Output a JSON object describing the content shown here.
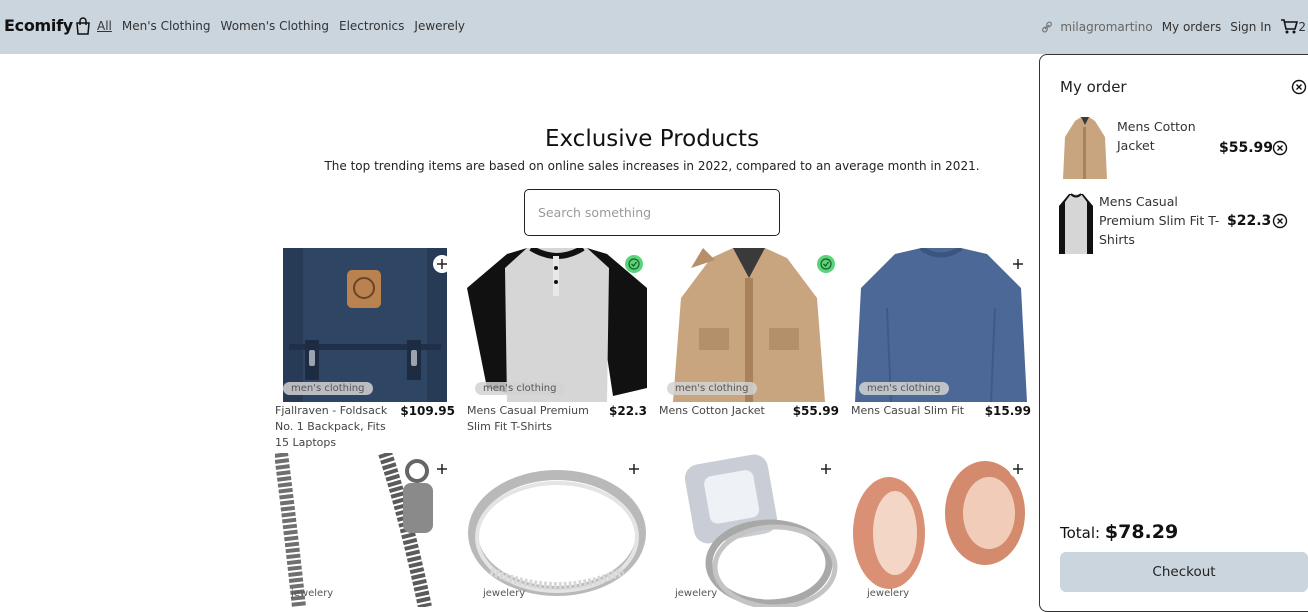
{
  "brand": {
    "name": "Ecomify"
  },
  "nav": {
    "links": [
      {
        "label": "All"
      },
      {
        "label": "Men's Clothing"
      },
      {
        "label": "Women's Clothing"
      },
      {
        "label": "Electronics"
      },
      {
        "label": "Jewerely"
      }
    ],
    "username": "milagromartino",
    "my_orders": "My orders",
    "sign_in": "Sign In",
    "cart_count": "2"
  },
  "hero": {
    "title": "Exclusive Products",
    "subtitle": "The top trending items are based on online sales increases in 2022, compared to an average month in 2021."
  },
  "search": {
    "placeholder": "Search something"
  },
  "products": [
    {
      "name": "Fjallraven - Foldsack No. 1 Backpack, Fits 15 Laptops",
      "price": "$109.95",
      "category": "men's clothing",
      "in_cart": false
    },
    {
      "name": "Mens Casual Premium Slim Fit T-Shirts",
      "price": "$22.3",
      "category": "men's clothing",
      "in_cart": true
    },
    {
      "name": "Mens Cotton Jacket",
      "price": "$55.99",
      "category": "men's clothing",
      "in_cart": true
    },
    {
      "name": "Mens Casual Slim Fit",
      "price": "$15.99",
      "category": "men's clothing",
      "in_cart": false
    },
    {
      "name": "",
      "price": "",
      "category": "jewelery",
      "in_cart": false
    },
    {
      "name": "",
      "price": "",
      "category": "jewelery",
      "in_cart": false
    },
    {
      "name": "",
      "price": "",
      "category": "jewelery",
      "in_cart": false
    },
    {
      "name": "",
      "price": "",
      "category": "jewelery",
      "in_cart": false
    }
  ],
  "order": {
    "title": "My order",
    "items": [
      {
        "name": "Mens Cotton Jacket",
        "price": "$55.99"
      },
      {
        "name": "Mens Casual Premium Slim Fit T-Shirts",
        "price": "$22.3"
      }
    ],
    "total_label": "Total:",
    "total_value": "$78.29",
    "checkout_label": "Checkout"
  },
  "colors": {
    "navbar": "#cbd5dd",
    "checkout": "#cbd5dd",
    "in_cart_badge": "#5ad47a"
  }
}
